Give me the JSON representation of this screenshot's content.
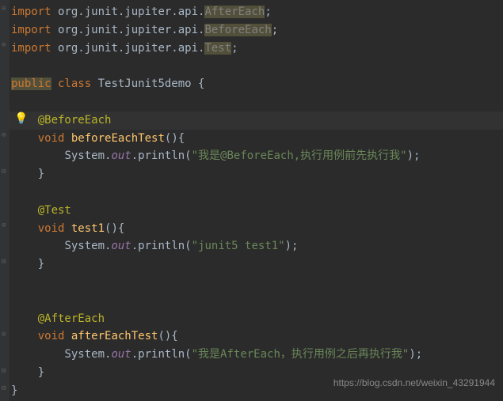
{
  "code": {
    "l1_import": "import ",
    "l1_pkg": "org.junit.jupiter.api.",
    "l1_cls": "AfterEach",
    "l1_semi": ";",
    "l2_import": "import ",
    "l2_pkg": "org.junit.jupiter.api.",
    "l2_cls": "BeforeEach",
    "l2_semi": ";",
    "l3_import": "import ",
    "l3_pkg": "org.junit.jupiter.api.",
    "l3_cls": "Test",
    "l3_semi": ";",
    "l5_pub": "public",
    "l5_class": " class ",
    "l5_name": "TestJunit5demo {",
    "l7_ann": "@BeforeEach",
    "l8_void": "void ",
    "l8_name": "beforeEachTest",
    "l8_paren": "(){",
    "l9_sys": "System.",
    "l9_out": "out",
    "l9_print": ".println(",
    "l9_str": "\"我是@BeforeEach,执行用例前先执行我\"",
    "l9_end": ");",
    "l10_close": "}",
    "l12_ann": "@Test",
    "l13_void": "void ",
    "l13_name": "test1",
    "l13_paren": "(){",
    "l14_sys": "System.",
    "l14_out": "out",
    "l14_print": ".println(",
    "l14_str": "\"junit5 test1\"",
    "l14_end": ");",
    "l15_close": "}",
    "l18_ann": "@AfterEach",
    "l19_void": "void ",
    "l19_name": "afterEachTest",
    "l19_paren": "(){",
    "l20_sys": "System.",
    "l20_out": "out",
    "l20_print": ".println(",
    "l20_str": "\"我是AfterEach，执行用例之后再执行我\"",
    "l20_end": ");",
    "l21_close": "}",
    "l22_close": "}"
  },
  "watermark": "https://blog.csdn.net/weixin_43291944"
}
